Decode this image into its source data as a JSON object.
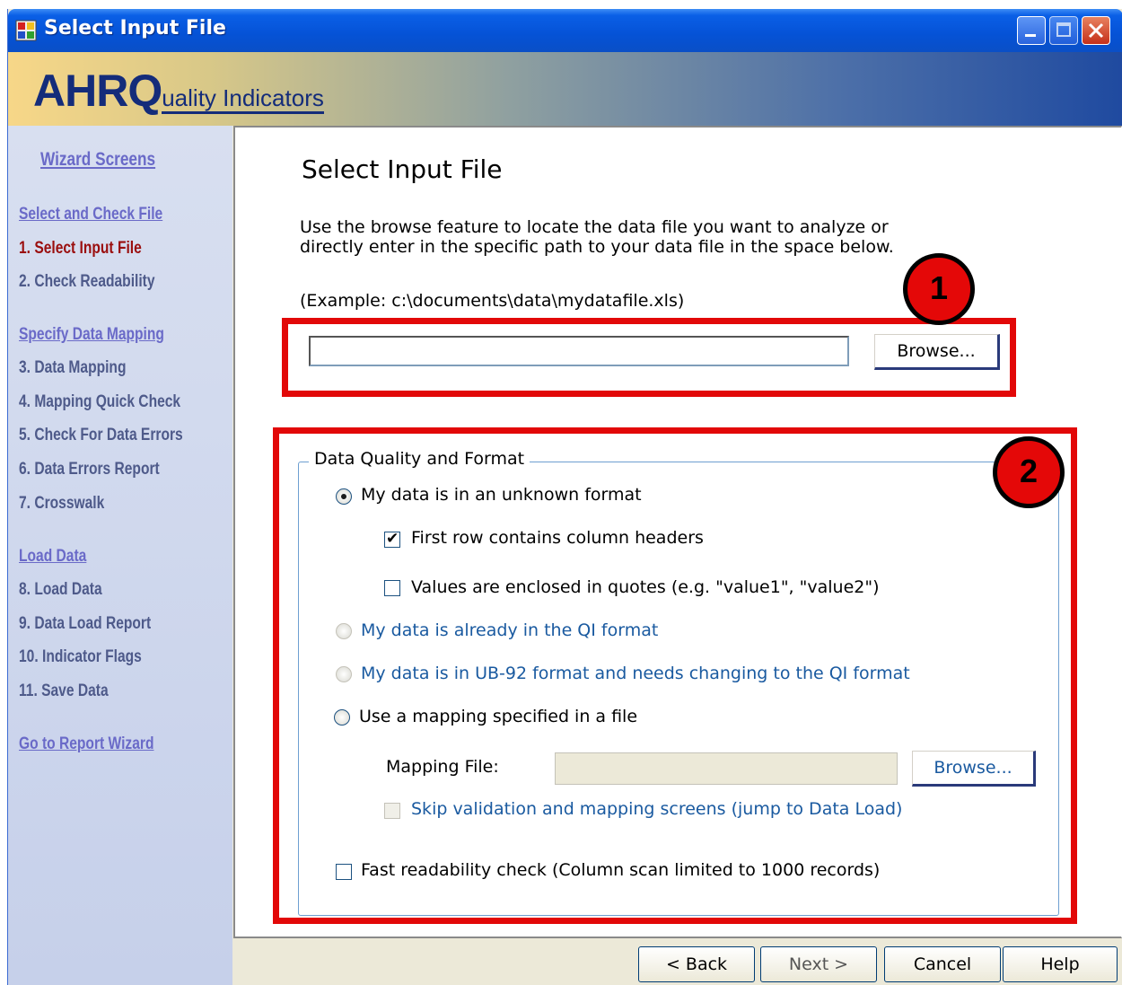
{
  "window": {
    "title": "Select Input File"
  },
  "banner": {
    "logo_big": "AHRQ",
    "logo_small": "uality Indicators"
  },
  "sidebar": {
    "title": "Wizard Screens",
    "sections": [
      {
        "header": "Select and Check File",
        "items": [
          "1. Select Input File",
          "2. Check Readability"
        ]
      },
      {
        "header": "Specify Data Mapping",
        "items": [
          "3. Data Mapping",
          "4. Mapping Quick Check",
          "5. Check For Data Errors",
          "6. Data Errors Report",
          "7. Crosswalk"
        ]
      },
      {
        "header": "Load Data",
        "items": [
          "8. Load Data",
          "9. Data Load Report",
          "10. Indicator Flags",
          "11. Save Data"
        ]
      }
    ],
    "report_link": "Go to Report Wizard",
    "active_item": "1. Select Input File"
  },
  "main": {
    "heading": "Select Input File",
    "description_line1": "Use the browse feature to locate the data file you want to analyze or",
    "description_line2": "directly enter in the specific path to your data file in the space below.",
    "example": "(Example: c:\\documents\\data\\mydatafile.xls)",
    "path_value": "",
    "browse_label": "Browse..."
  },
  "annotations": {
    "badge1": "1",
    "badge2": "2",
    "highlight_color": "#e20808"
  },
  "group": {
    "title": "Data Quality and Format",
    "opt_unknown": "My data is in an unknown format",
    "chk_headers": "First row contains column headers",
    "chk_quotes": "Values are enclosed in quotes (e.g. \"value1\", \"value2\")",
    "opt_qi": "My data is already in the QI format",
    "opt_ub92": "My data is in UB-92 format and needs changing to the QI format",
    "opt_mapping": "Use a mapping specified in a file",
    "mapping_label": "Mapping File:",
    "mapping_value": "",
    "mapping_browse": "Browse...",
    "chk_skip": "Skip validation and mapping screens (jump to Data Load)",
    "chk_fast": "Fast readability check  (Column scan limited to 1000 records)"
  },
  "footer": {
    "back": "< Back",
    "next": "Next >",
    "cancel": "Cancel",
    "help": "Help"
  }
}
